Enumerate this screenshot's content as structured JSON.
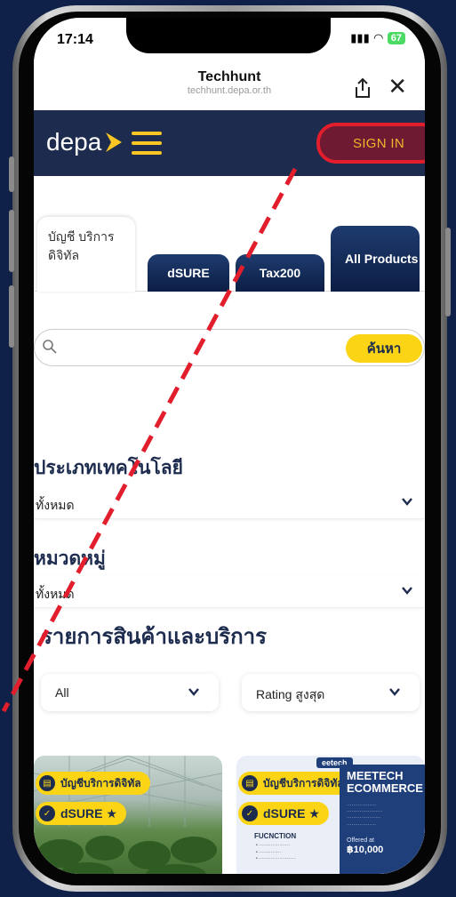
{
  "status_bar": {
    "time": "17:14",
    "battery": "67"
  },
  "browser": {
    "title": "Techhunt",
    "domain": "techhunt.depa.or.th"
  },
  "header": {
    "logo_text": "depa",
    "signin_label": "SIGN IN"
  },
  "tabs": [
    {
      "label": "บัญชี บริการ ดิจิทัล",
      "active": true
    },
    {
      "label": "dSURE",
      "active": false
    },
    {
      "label": "Tax200",
      "active": false
    },
    {
      "label": "All Products",
      "active": false
    }
  ],
  "search": {
    "placeholder": "",
    "button_label": "ค้นหา"
  },
  "filters": {
    "tech_type": {
      "title": "ประเภทเทคโนโลยี",
      "value": "ทั้งหมด"
    },
    "category": {
      "title": "หมวดหมู่",
      "value": "ทั้งหมด"
    }
  },
  "products": {
    "title": "รายการสินค้าและบริการ",
    "filter_all": "All",
    "sort": "Rating สูงสุด",
    "cards": [
      {
        "badge1": "บัญชีบริการดิจิทัล",
        "badge2": "dSURE ★"
      },
      {
        "badge1": "บัญชีบริการดิจิทัล",
        "badge2": "dSURE ★",
        "brand": "eetech",
        "promo_title": "MEETECH ECOMMERCE",
        "func_label": "FUCNCTION",
        "offer_label": "Offered at",
        "price": "฿10,000"
      }
    ]
  },
  "colors": {
    "background": "#0f2148",
    "header": "#1d2c4e",
    "accent": "#fbd415",
    "signin_bg": "#6e1a32",
    "annotation": "#e21e2c"
  }
}
